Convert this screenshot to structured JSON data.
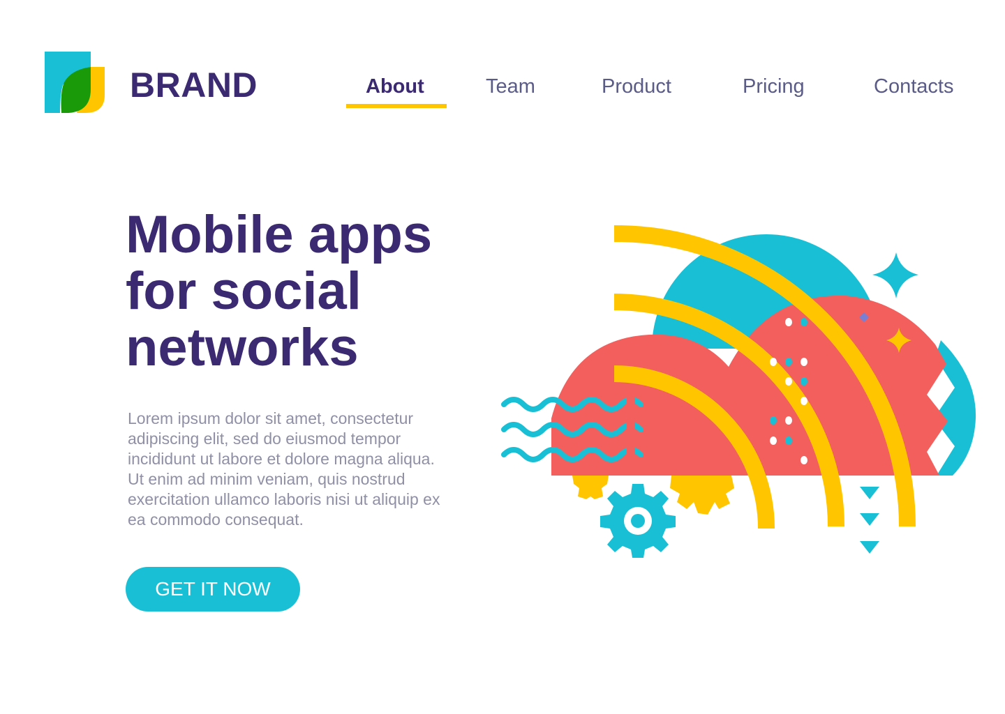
{
  "header": {
    "brand": "BRAND",
    "nav": [
      {
        "label": "About",
        "active": true
      },
      {
        "label": "Team",
        "active": false
      },
      {
        "label": "Product",
        "active": false
      },
      {
        "label": "Pricing",
        "active": false
      },
      {
        "label": "Contacts",
        "active": false
      }
    ]
  },
  "hero": {
    "title_lines": [
      "Mobile apps",
      "for social",
      "networks"
    ],
    "body_lines": [
      "Lorem ipsum dolor sit amet, consectetur",
      "adipiscing elit, sed do eiusmod tempor",
      "incididunt ut labore et dolore magna aliqua.",
      "Ut enim ad minim veniam, quis nostrud",
      "exercitation ullamco laboris nisi ut aliquip ex",
      "ea commodo consequat."
    ],
    "cta_label": "GET IT NOW"
  },
  "colors": {
    "brand_purple": "#3b2a72",
    "accent_yellow": "#ffc600",
    "accent_cyan": "#19c0d5",
    "coral": "#f25f5c",
    "green": "#1a9a08",
    "nav_text": "#5a5b86",
    "body_text": "#8f90a6"
  },
  "icons": [
    "brand-logo-icon",
    "cloud-illustration",
    "gear-icon",
    "sparkle-icon"
  ]
}
